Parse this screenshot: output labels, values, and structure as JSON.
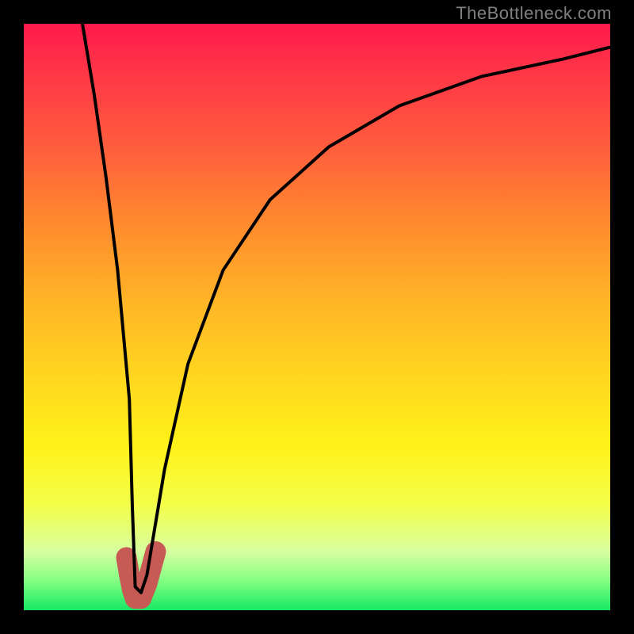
{
  "watermark": "TheBottleneck.com",
  "chart_data": {
    "type": "line",
    "title": "",
    "xlabel": "",
    "ylabel": "",
    "xlim": [
      0,
      100
    ],
    "ylim": [
      0,
      100
    ],
    "series": [
      {
        "name": "bottleneck-curve",
        "x": [
          10,
          12,
          14,
          16,
          18,
          18.5,
          19,
          20,
          21,
          22,
          24,
          28,
          34,
          42,
          52,
          64,
          78,
          92,
          100
        ],
        "values": [
          100,
          88,
          74,
          58,
          36,
          18,
          4,
          3,
          6,
          12,
          24,
          42,
          58,
          70,
          79,
          86,
          91,
          94,
          96
        ]
      }
    ],
    "marker": {
      "name": "highlight-segment",
      "color": "#c85a55",
      "x": [
        17.5,
        18,
        18.5,
        19,
        20,
        21,
        22.5
      ],
      "values": [
        9,
        6,
        3.5,
        2,
        2,
        4.5,
        10
      ]
    }
  }
}
